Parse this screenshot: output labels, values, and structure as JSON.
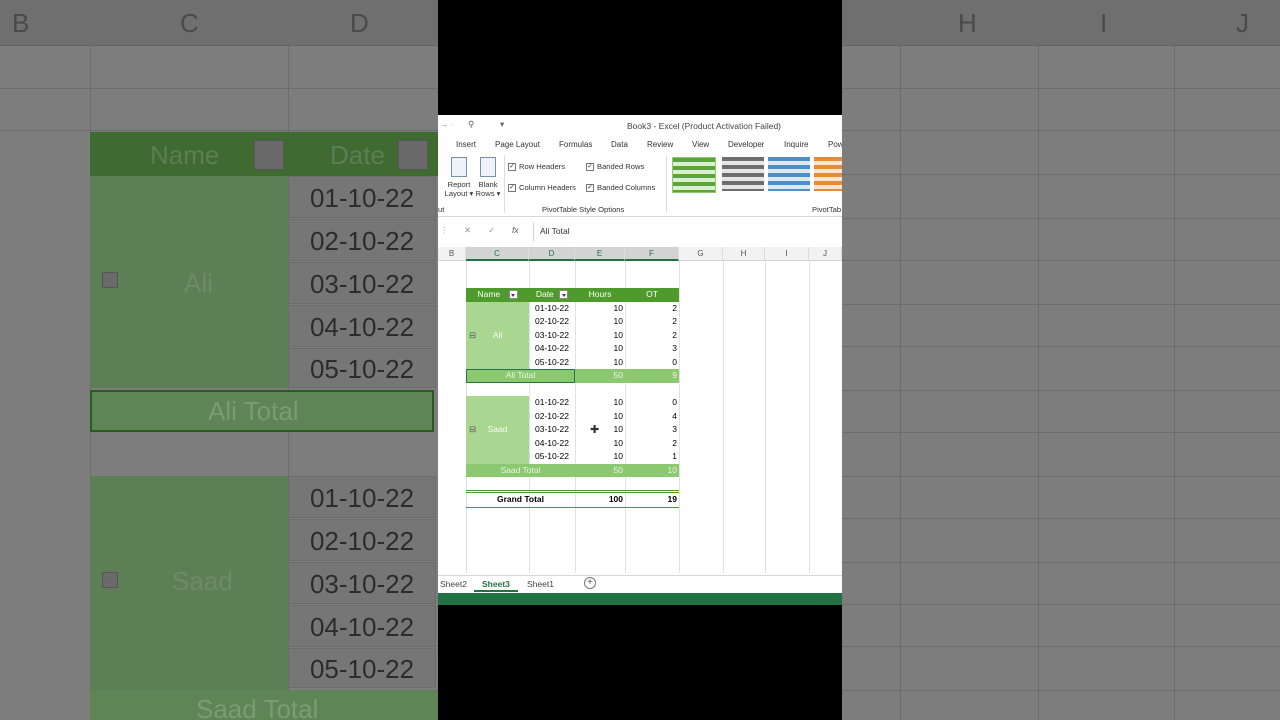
{
  "window": {
    "title": "Book3 - Excel (Product Activation Failed)"
  },
  "ribbon_tabs": [
    "Insert",
    "Page Layout",
    "Formulas",
    "Data",
    "Review",
    "View",
    "Developer",
    "Inquire",
    "Pow"
  ],
  "ribbon": {
    "report_layout": "Report",
    "report_layout_2": "Layout",
    "blank_rows": "Blank",
    "blank_rows_2": "Rows",
    "row_headers": "Row Headers",
    "column_headers": "Column Headers",
    "banded_rows": "Banded Rows",
    "banded_columns": "Banded Columns",
    "group_label": "PivotTable Style Options",
    "styles_label": "PivotTab",
    "cut_label": "ut",
    "row_headers_checked": true,
    "column_headers_checked": true,
    "banded_rows_checked": true,
    "banded_columns_checked": true
  },
  "formula_bar": {
    "fx": "fx",
    "value": "Ali Total"
  },
  "columns": [
    "B",
    "C",
    "D",
    "E",
    "F",
    "G",
    "H",
    "I",
    "J"
  ],
  "pivot": {
    "headers": {
      "name": "Name",
      "date": "Date",
      "hours": "Hours",
      "ot": "OT"
    },
    "groups": [
      {
        "name": "Ali",
        "rows": [
          {
            "date": "01-10-22",
            "hours": "10",
            "ot": "2"
          },
          {
            "date": "02-10-22",
            "hours": "10",
            "ot": "2"
          },
          {
            "date": "03-10-22",
            "hours": "10",
            "ot": "2"
          },
          {
            "date": "04-10-22",
            "hours": "10",
            "ot": "3"
          },
          {
            "date": "05-10-22",
            "hours": "10",
            "ot": "0"
          }
        ],
        "total_label": "Ali Total",
        "total_hours": "50",
        "total_ot": "9"
      },
      {
        "name": "Saad",
        "rows": [
          {
            "date": "01-10-22",
            "hours": "10",
            "ot": "0"
          },
          {
            "date": "02-10-22",
            "hours": "10",
            "ot": "4"
          },
          {
            "date": "03-10-22",
            "hours": "10",
            "ot": "3"
          },
          {
            "date": "04-10-22",
            "hours": "10",
            "ot": "2"
          },
          {
            "date": "05-10-22",
            "hours": "10",
            "ot": "1"
          }
        ],
        "total_label": "Saad Total",
        "total_hours": "50",
        "total_ot": "10"
      }
    ],
    "grand_total": {
      "label": "Grand Total",
      "hours": "100",
      "ot": "19"
    }
  },
  "sheet_tabs": [
    "Sheet2",
    "Sheet3",
    "Sheet1"
  ],
  "active_sheet": "Sheet3",
  "background": {
    "left_cols": [
      "B",
      "C",
      "D"
    ],
    "right_cols": [
      "H",
      "I",
      "J"
    ],
    "name_header": "Name",
    "date_header": "Date",
    "ali": "Ali",
    "saad": "Saad",
    "ali_total": "Ali Total",
    "saad_total": "Saad Total",
    "dates": [
      "01-10-22",
      "02-10-22",
      "03-10-22",
      "04-10-22",
      "05-10-22"
    ]
  },
  "colors": {
    "excel_green": "#217346",
    "pivot_header": "#4e9a2c",
    "pivot_light": "#a9d792"
  }
}
